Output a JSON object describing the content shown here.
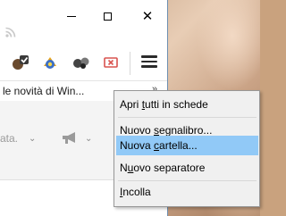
{
  "window": {
    "caption_buttons": [
      "minimize",
      "maximize",
      "close"
    ],
    "close_glyph": "✕"
  },
  "toolbar": {
    "icons": [
      "rss-icon",
      "pocket-check-icon",
      "puzzle-extension-icon",
      "circles-extension-icon",
      "screen-x-icon"
    ],
    "menu_button": "hamburger-icon"
  },
  "bookmarks_bar": {
    "visible_text": "le novità di Win...",
    "overflow": "»"
  },
  "subbar": {
    "left_text": "ata.",
    "chevron": "⌄"
  },
  "context_menu": {
    "items": [
      {
        "pre": "Apri ",
        "u": "t",
        "post": "utti in schede"
      },
      {
        "pre": "Nuovo ",
        "u": "s",
        "post": "egnalibro..."
      },
      {
        "pre": "Nuova ",
        "u": "c",
        "post": "artella...",
        "highlighted": true
      },
      {
        "pre": "N",
        "u": "u",
        "post": "ovo separatore"
      },
      {
        "pre": "",
        "u": "I",
        "post": "ncolla"
      }
    ]
  },
  "colors": {
    "highlight": "#91c9f7",
    "menu_bg": "#f0f0f0"
  }
}
